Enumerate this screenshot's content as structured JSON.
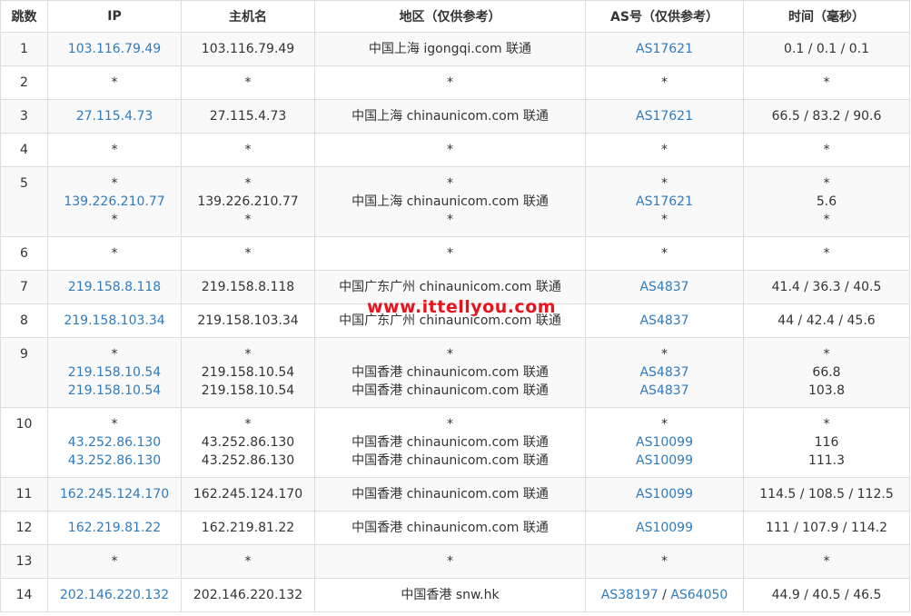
{
  "headers": [
    "跳数",
    "IP",
    "主机名",
    "地区（仅供参考）",
    "AS号（仅供参考）",
    "时间（毫秒）"
  ],
  "watermark": "www.ittellyou.com",
  "colors": {
    "link": "#2f7bbf",
    "border": "#dddddd",
    "watermark": "#e8131c",
    "stripe": "#f9f9f9"
  },
  "rows": [
    {
      "hop": "1",
      "lines": [
        {
          "ip": "103.116.79.49",
          "host": "103.116.79.49",
          "region": "中国上海 igongqi.com 联通",
          "as": [
            "AS17621"
          ],
          "time": "0.1 / 0.1 / 0.1"
        }
      ]
    },
    {
      "hop": "2",
      "lines": [
        {
          "ip": "*",
          "host": "*",
          "region": "*",
          "as": [
            "*"
          ],
          "time": "*"
        }
      ]
    },
    {
      "hop": "3",
      "lines": [
        {
          "ip": "27.115.4.73",
          "host": "27.115.4.73",
          "region": "中国上海 chinaunicom.com 联通",
          "as": [
            "AS17621"
          ],
          "time": "66.5 / 83.2 / 90.6"
        }
      ]
    },
    {
      "hop": "4",
      "lines": [
        {
          "ip": "*",
          "host": "*",
          "region": "*",
          "as": [
            "*"
          ],
          "time": "*"
        }
      ]
    },
    {
      "hop": "5",
      "lines": [
        {
          "ip": "*",
          "host": "*",
          "region": "*",
          "as": [
            "*"
          ],
          "time": "*"
        },
        {
          "ip": "139.226.210.77",
          "host": "139.226.210.77",
          "region": "中国上海 chinaunicom.com 联通",
          "as": [
            "AS17621"
          ],
          "time": "5.6"
        },
        {
          "ip": "*",
          "host": "*",
          "region": "*",
          "as": [
            "*"
          ],
          "time": "*"
        }
      ]
    },
    {
      "hop": "6",
      "lines": [
        {
          "ip": "*",
          "host": "*",
          "region": "*",
          "as": [
            "*"
          ],
          "time": "*"
        }
      ]
    },
    {
      "hop": "7",
      "lines": [
        {
          "ip": "219.158.8.118",
          "host": "219.158.8.118",
          "region": "中国广东广州 chinaunicom.com 联通",
          "as": [
            "AS4837"
          ],
          "time": "41.4 / 36.3 / 40.5"
        }
      ]
    },
    {
      "hop": "8",
      "lines": [
        {
          "ip": "219.158.103.34",
          "host": "219.158.103.34",
          "region": "中国广东广州 chinaunicom.com 联通",
          "as": [
            "AS4837"
          ],
          "time": "44 / 42.4 / 45.6"
        }
      ]
    },
    {
      "hop": "9",
      "lines": [
        {
          "ip": "*",
          "host": "*",
          "region": "*",
          "as": [
            "*"
          ],
          "time": "*"
        },
        {
          "ip": "219.158.10.54",
          "host": "219.158.10.54",
          "region": "中国香港 chinaunicom.com 联通",
          "as": [
            "AS4837"
          ],
          "time": "66.8"
        },
        {
          "ip": "219.158.10.54",
          "host": "219.158.10.54",
          "region": "中国香港 chinaunicom.com 联通",
          "as": [
            "AS4837"
          ],
          "time": "103.8"
        }
      ]
    },
    {
      "hop": "10",
      "lines": [
        {
          "ip": "*",
          "host": "*",
          "region": "*",
          "as": [
            "*"
          ],
          "time": "*"
        },
        {
          "ip": "43.252.86.130",
          "host": "43.252.86.130",
          "region": "中国香港 chinaunicom.com 联通",
          "as": [
            "AS10099"
          ],
          "time": "116"
        },
        {
          "ip": "43.252.86.130",
          "host": "43.252.86.130",
          "region": "中国香港 chinaunicom.com 联通",
          "as": [
            "AS10099"
          ],
          "time": "111.3"
        }
      ]
    },
    {
      "hop": "11",
      "lines": [
        {
          "ip": "162.245.124.170",
          "host": "162.245.124.170",
          "region": "中国香港 chinaunicom.com 联通",
          "as": [
            "AS10099"
          ],
          "time": "114.5 / 108.5 / 112.5"
        }
      ]
    },
    {
      "hop": "12",
      "lines": [
        {
          "ip": "162.219.81.22",
          "host": "162.219.81.22",
          "region": "中国香港 chinaunicom.com 联通",
          "as": [
            "AS10099"
          ],
          "time": "111 / 107.9 / 114.2"
        }
      ]
    },
    {
      "hop": "13",
      "lines": [
        {
          "ip": "*",
          "host": "*",
          "region": "*",
          "as": [
            "*"
          ],
          "time": "*"
        }
      ]
    },
    {
      "hop": "14",
      "lines": [
        {
          "ip": "202.146.220.132",
          "host": "202.146.220.132",
          "region": "中国香港 snw.hk",
          "as": [
            "AS38197",
            "AS64050"
          ],
          "time": "44.9 / 40.5 / 46.5"
        }
      ]
    }
  ]
}
